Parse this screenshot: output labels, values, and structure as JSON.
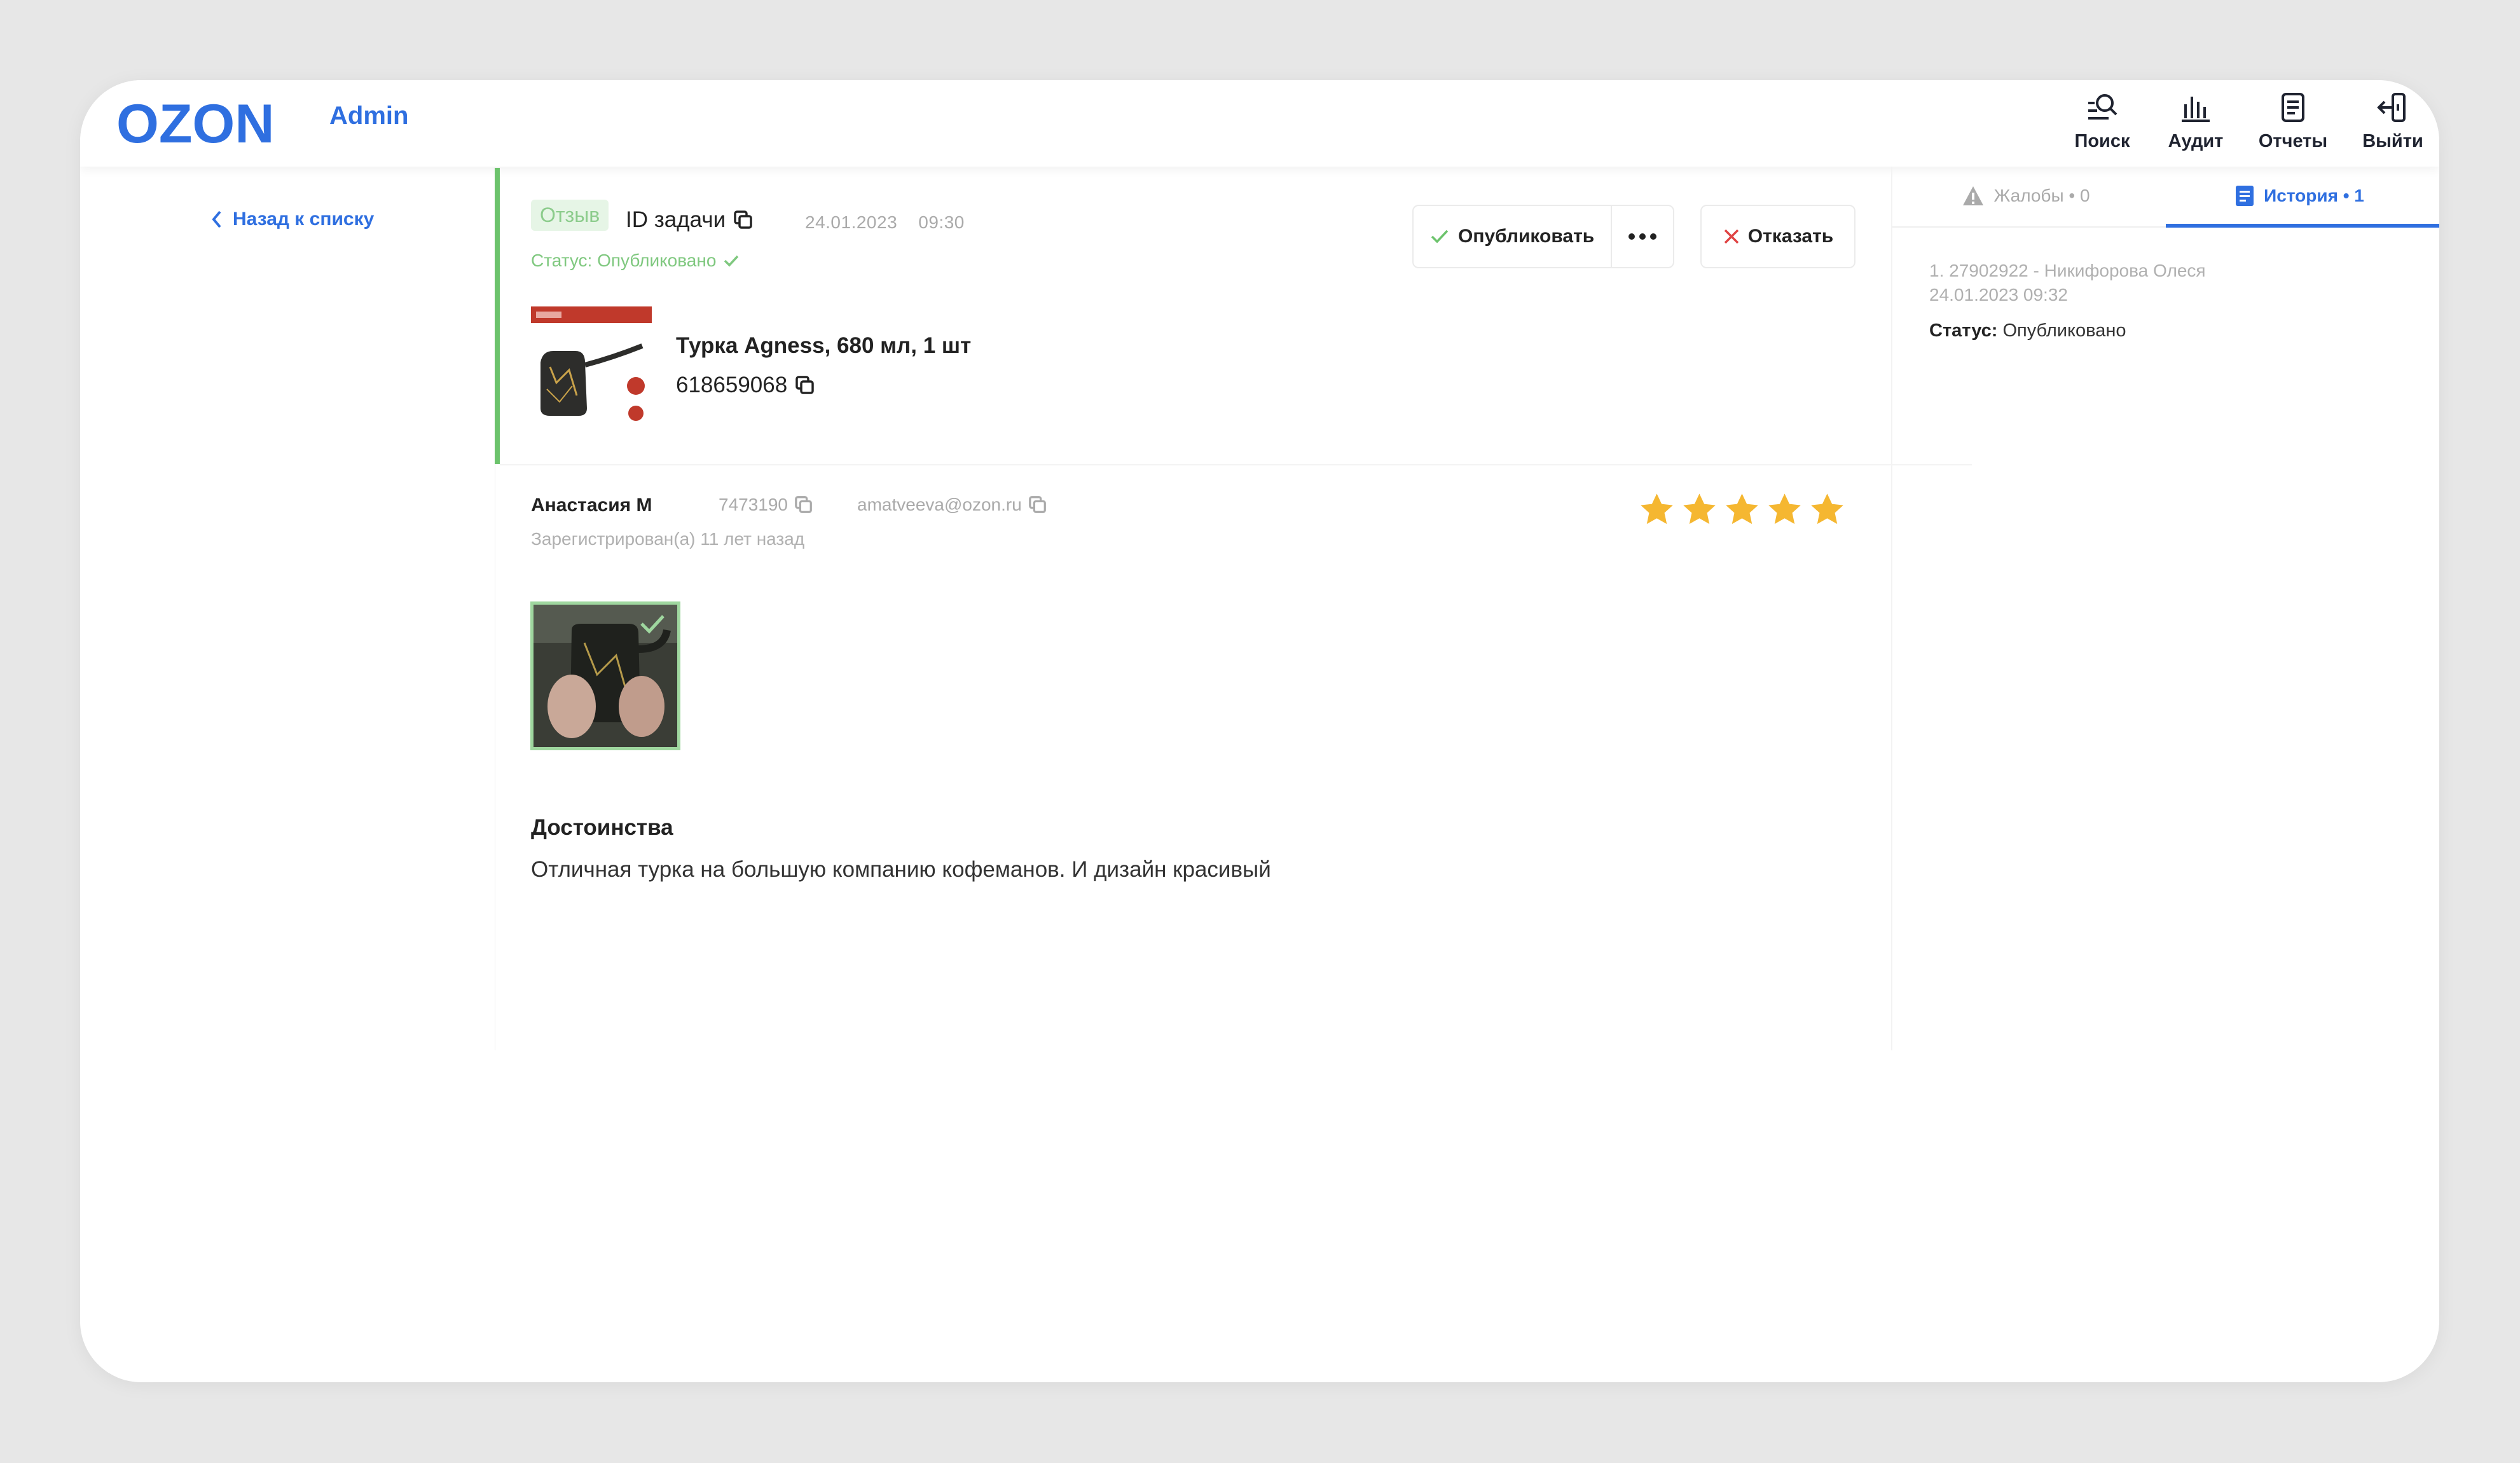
{
  "header": {
    "brand": "OZON",
    "admin_label": "Admin",
    "nav": [
      {
        "label": "Поиск",
        "icon": "search-icon"
      },
      {
        "label": "Аудит",
        "icon": "audit-icon"
      },
      {
        "label": "Отчеты",
        "icon": "reports-icon"
      },
      {
        "label": "Выйти",
        "icon": "logout-icon"
      }
    ]
  },
  "back_link": "Назад к списку",
  "task": {
    "type_badge": "Отзыв",
    "id_label": "ID задачи",
    "date": "24.01.2023",
    "time": "09:30",
    "status": "Статус: Опубликовано"
  },
  "actions": {
    "publish": "Опубликовать",
    "reject": "Отказать"
  },
  "product": {
    "title": "Турка Agness, 680 мл, 1 шт",
    "sku": "618659068"
  },
  "review": {
    "author": "Анастасия М",
    "author_id": "7473190",
    "email": "amatveeva@ozon.ru",
    "registered": "Зарегистрирован(а) 11 лет назад",
    "rating": 5,
    "section_title": "Достоинства",
    "section_text": "Отличная турка на большую компанию кофеманов. И дизайн красивый"
  },
  "side_panel": {
    "tabs": [
      {
        "label": "Жалобы • 0",
        "icon": "warning-icon"
      },
      {
        "label": "История • 1",
        "icon": "history-icon"
      }
    ],
    "history": {
      "line1": "1. 27902922 - Никифорова Олеся",
      "line2": "24.01.2023   09:32",
      "status_label": "Статус:",
      "status_value": "Опубликовано"
    }
  },
  "colors": {
    "accent": "#2f6fe0",
    "success": "#6cc36c",
    "star": "#f5b731",
    "reject": "#e04545"
  }
}
